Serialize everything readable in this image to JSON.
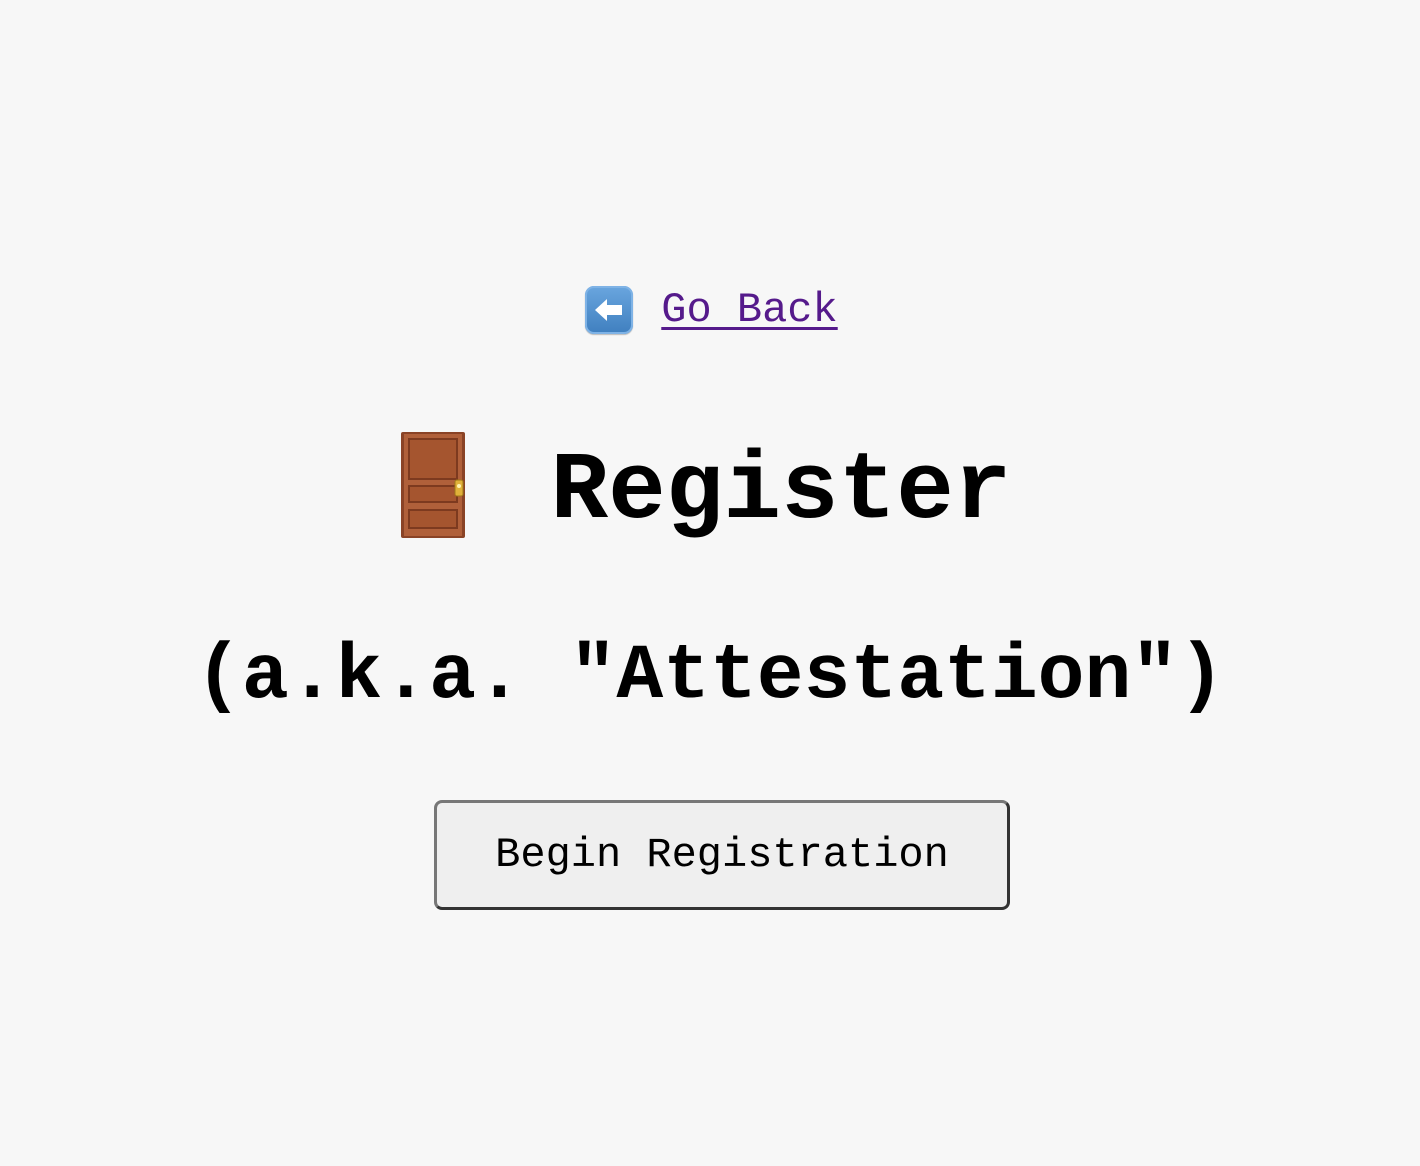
{
  "nav": {
    "back_icon": "left-arrow-icon",
    "back_label": "Go Back"
  },
  "header": {
    "icon": "door-icon",
    "title": "Register",
    "subtitle": "(a.k.a. \"Attestation\")"
  },
  "actions": {
    "begin_label": "Begin Registration"
  },
  "colors": {
    "background": "#f7f7f7",
    "link_visited": "#551a8b",
    "button_bg": "#efefef"
  }
}
